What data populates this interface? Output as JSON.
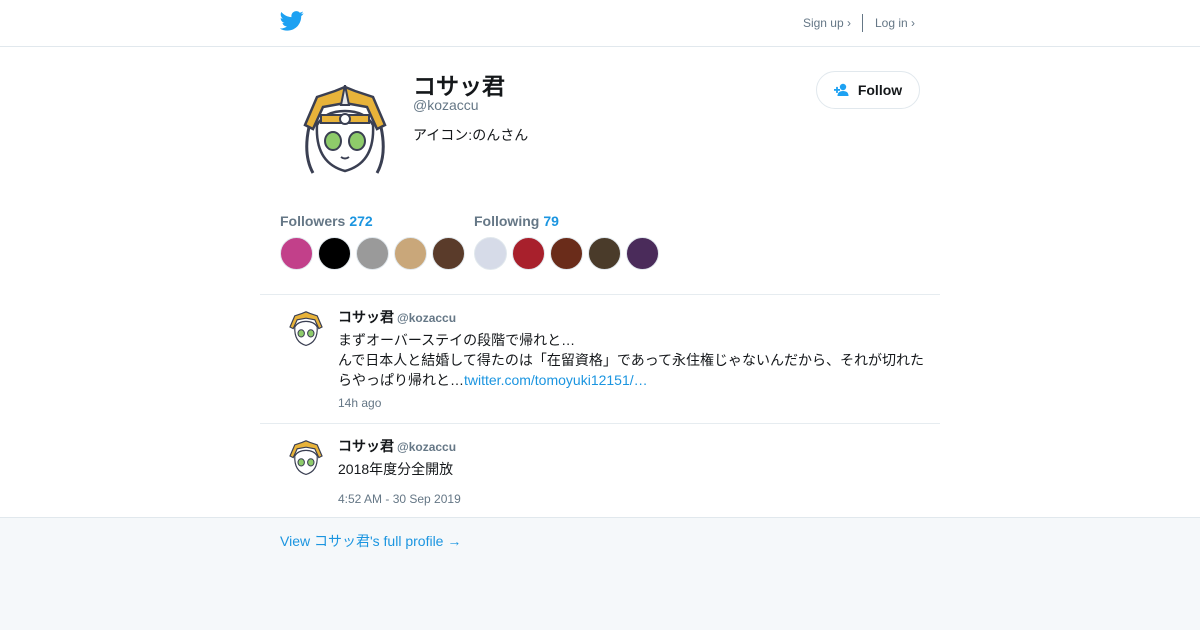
{
  "header": {
    "signup_label": "Sign up ›",
    "login_label": "Log in ›",
    "logo_icon": "twitter-bird-icon",
    "brand_color": "#1da1f2"
  },
  "profile": {
    "name": "コサッ君",
    "handle": "@kozaccu",
    "bio": "アイコン:のんさん",
    "follow_label": "Follow",
    "follow_icon": "add-user-icon"
  },
  "stats": {
    "followers_label": "Followers",
    "followers_count": "272",
    "following_label": "Following",
    "following_count": "79"
  },
  "follower_avatar_colors": [
    "#c2408a",
    "#000000",
    "#9a9a9a",
    "#c9a77a",
    "#5a3b2a"
  ],
  "following_avatar_colors": [
    "#d6dbe8",
    "#a8202c",
    "#6a2c1a",
    "#4a3b2a",
    "#4a2b5a"
  ],
  "tweets": [
    {
      "name": "コサッ君",
      "handle": "@kozaccu",
      "line1": "まずオーバーステイの段階で帰れと…",
      "line2": "んで日本人と結婚して得たのは「在留資格」であって永住権じゃないんだから、それが切れた",
      "line3": "らやっぱり帰れと…",
      "link": "twitter.com/tomoyuki12151/…",
      "time": "14h ago"
    },
    {
      "name": "コサッ君",
      "handle": "@kozaccu",
      "text": "2018年度分全開放",
      "time": "4:52 AM - 30 Sep 2019"
    }
  ],
  "footer": {
    "link_label": "View コサッ君's full profile →"
  }
}
